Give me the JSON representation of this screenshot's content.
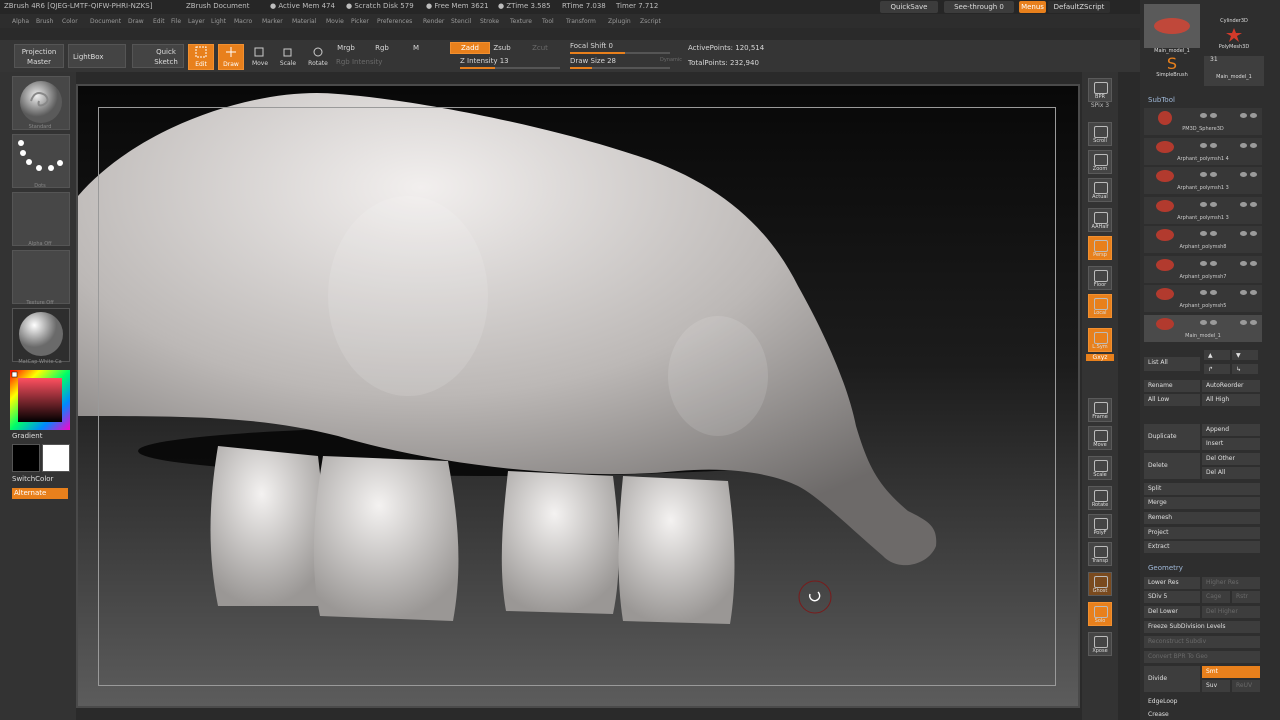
{
  "titlebar": {
    "app": "ZBrush 4R6 [QJEG-LMTF-QIFW-PHRI-NZKS]",
    "document": "ZBrush Document",
    "active_mem": "● Active Mem 474",
    "scratch_disk": "● Scratch Disk 579",
    "free_mem": "● Free Mem 3621",
    "ztime": "● ZTime 3.585",
    "rtime": "RTime 7.038",
    "timer": "Timer 7.712",
    "quicksave": "QuickSave",
    "see_through": "See-through  0",
    "menus": "Menus",
    "default_zscript": "DefaultZScript"
  },
  "menubar": [
    "Alpha",
    "Brush",
    "Color",
    "Document",
    "Draw",
    "Edit",
    "File",
    "Layer",
    "Light",
    "Macro",
    "Marker",
    "Material",
    "Movie",
    "Picker",
    "Preferences",
    "Render",
    "Stencil",
    "Stroke",
    "Texture",
    "Tool",
    "Transform",
    "Zplugin",
    "Zscript"
  ],
  "toolbar": {
    "projection_master": "Projection Master",
    "lightbox": "LightBox",
    "quick_sketch": "Quick Sketch",
    "edit": "Edit",
    "draw": "Draw",
    "move": "Move",
    "scale": "Scale",
    "rotate": "Rotate",
    "mrgb": "Mrgb",
    "rgb": "Rgb",
    "m": "M",
    "rgb_intensity": "Rgb Intensity",
    "zadd": "Zadd",
    "zsub": "Zsub",
    "zcut": "Zcut",
    "z_intensity": "Z Intensity 13",
    "focal_shift": "Focal Shift 0",
    "draw_size": "Draw Size 28",
    "dynamic": "Dynamic",
    "active_points": "ActivePoints: 120,514",
    "total_points": "TotalPoints: 232,940"
  },
  "left_tray": {
    "brush": "Standard",
    "stroke": "Dots",
    "alpha": "Alpha  Off",
    "texture": "Texture  Off",
    "material": "MatCap White Ca",
    "gradient": "Gradient",
    "switch_color": "SwitchColor",
    "alternate": "Alternate"
  },
  "right_shelf": [
    "BPR",
    "SPix 3",
    "Scroll",
    "Zoom",
    "Actual",
    "AAHalf",
    "Persp",
    "Floor",
    "Local",
    "L.Sym",
    "Gxyz",
    "Frame",
    "Move",
    "Scale",
    "Rotate",
    "PolyF",
    "Transp",
    "Ghost",
    "Solo",
    "Xpose"
  ],
  "tool_palette": {
    "thumbs": [
      "Main_model_1",
      "Cylinder3D",
      "PolyMesh3D",
      "SimpleBrush",
      "Main_model_1"
    ],
    "thumb_count": "31"
  },
  "subtool": {
    "header": "SubTool",
    "items": [
      "PM3D_Sphere3D",
      "Arphant_polymsh1 4",
      "Arphant_polymsh1 3",
      "Arphant_polymsh1 3",
      "Arphant_polymsh8",
      "Arphant_polymsh7",
      "Arphant_polymsh5",
      "Main_model_1"
    ],
    "list_all": "List  All",
    "rename": "Rename",
    "auto_reorder": "AutoReorder",
    "all_low": "All Low",
    "all_high": "All High",
    "append": "Append",
    "insert": "Insert",
    "duplicate": "Duplicate",
    "delete": "Delete",
    "del_other": "Del Other",
    "del_all": "Del All",
    "split": "Split",
    "merge": "Merge",
    "remesh": "Remesh",
    "project": "Project",
    "extract": "Extract"
  },
  "geometry": {
    "header": "Geometry",
    "lower_res": "Lower Res",
    "higher_res": "Higher Res",
    "sdiv": "SDiv 5",
    "cage": "Cage",
    "rstr": "Rstr",
    "del_lower": "Del Lower",
    "del_higher": "Del Higher",
    "freeze": "Freeze SubDivision Levels",
    "reconstruct": "Reconstruct Subdiv",
    "convert_bpr": "Convert BPR To Geo",
    "divide": "Divide",
    "smt": "Smt",
    "suv": "Suv",
    "reuv": "ReUV",
    "edgeloop": "EdgeLoop",
    "crease": "Crease"
  },
  "colors": {
    "accent": "#e8801c",
    "panel": "#2e2e2e",
    "subtool_blob": "#b23a2e"
  }
}
